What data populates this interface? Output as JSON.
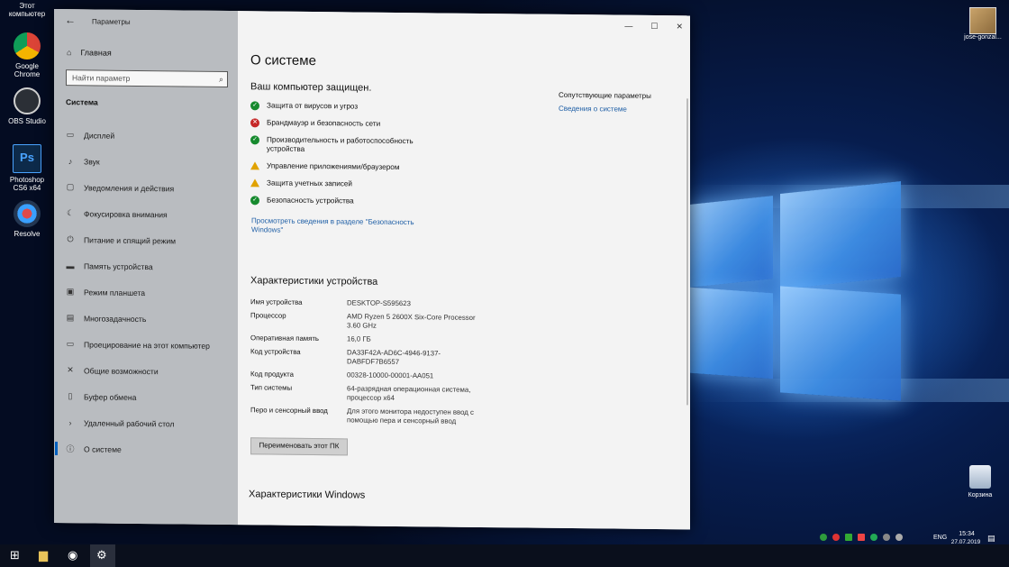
{
  "desktop": {
    "top_label": "Этот компьютер",
    "icons": [
      {
        "label": "Google Chrome",
        "icon": "chrome-icon",
        "color": "#e0b020"
      },
      {
        "label": "OBS Studio",
        "icon": "obs-icon",
        "color": "#303640"
      },
      {
        "label": "Photoshop CS6 x64",
        "icon": "photoshop-icon",
        "color": "#0b3a66"
      },
      {
        "label": "Resolve",
        "icon": "resolve-icon",
        "color": "#2a3d66"
      }
    ],
    "user_name": "jose-gonzal...",
    "recycle_bin": "Корзина"
  },
  "window": {
    "title": "Параметры",
    "sidebar": {
      "home": "Главная",
      "search_placeholder": "Найти параметр",
      "section": "Система",
      "items": [
        {
          "label": "Дисплей",
          "icon": "display-icon",
          "glyph": "▭"
        },
        {
          "label": "Звук",
          "icon": "sound-icon",
          "glyph": "♪"
        },
        {
          "label": "Уведомления и действия",
          "icon": "notifications-icon",
          "glyph": "▢"
        },
        {
          "label": "Фокусировка внимания",
          "icon": "focus-moon-icon",
          "glyph": "☾"
        },
        {
          "label": "Питание и спящий режим",
          "icon": "power-icon",
          "glyph": "⏻"
        },
        {
          "label": "Память устройства",
          "icon": "storage-icon",
          "glyph": "▬"
        },
        {
          "label": "Режим планшета",
          "icon": "tablet-icon",
          "glyph": "▣"
        },
        {
          "label": "Многозадачность",
          "icon": "multitasking-icon",
          "glyph": "▤"
        },
        {
          "label": "Проецирование на этот компьютер",
          "icon": "projecting-icon",
          "glyph": "▭"
        },
        {
          "label": "Общие возможности",
          "icon": "shared-experiences-icon",
          "glyph": "✕"
        },
        {
          "label": "Буфер обмена",
          "icon": "clipboard-icon",
          "glyph": "▯"
        },
        {
          "label": "Удаленный рабочий стол",
          "icon": "remote-desktop-icon",
          "glyph": "›"
        },
        {
          "label": "О системе",
          "icon": "about-info-icon",
          "glyph": "ⓘ",
          "active": true
        }
      ]
    },
    "main": {
      "page_title": "О системе",
      "protection_title": "Ваш компьютер защищен.",
      "statuses": [
        {
          "label": "Защита от вирусов и угроз",
          "state": "ok"
        },
        {
          "label": "Брандмауэр и безопасность сети",
          "state": "error"
        },
        {
          "label": "Производительность и работоспособность устройства",
          "state": "ok"
        },
        {
          "label": "Управление приложениями/браузером",
          "state": "warning"
        },
        {
          "label": "Защита учетных записей",
          "state": "warning"
        },
        {
          "label": "Безопасность устройства",
          "state": "ok"
        }
      ],
      "security_link": "Просмотреть сведения в разделе \"Безопасность Windows\"",
      "related_header": "Сопутствующие параметры",
      "related_link": "Сведения о системе",
      "device_title": "Характеристики устройства",
      "specs": [
        {
          "key": "Имя устройства",
          "value": "DESKTOP-S595623"
        },
        {
          "key": "Процессор",
          "value": "AMD Ryzen 5 2600X Six-Core Processor 3.60 GHz"
        },
        {
          "key": "Оперативная память",
          "value": "16,0 ГБ"
        },
        {
          "key": "Код устройства",
          "value": "DA33F42A-AD6C-4946-9137-DABFDF7B6557"
        },
        {
          "key": "Код продукта",
          "value": "00328-10000-00001-AA051"
        },
        {
          "key": "Тип системы",
          "value": "64-разрядная операционная система, процессор x64"
        },
        {
          "key": "Перо и сенсорный ввод",
          "value": "Для этого монитора недоступен ввод с помощью пера и сенсорный ввод"
        }
      ],
      "rename_button": "Переименовать этот ПК",
      "windows_title": "Характеристики Windows"
    }
  },
  "taskbar": {
    "language": "ENG",
    "time": "15:34",
    "date": "27.07.2019"
  }
}
